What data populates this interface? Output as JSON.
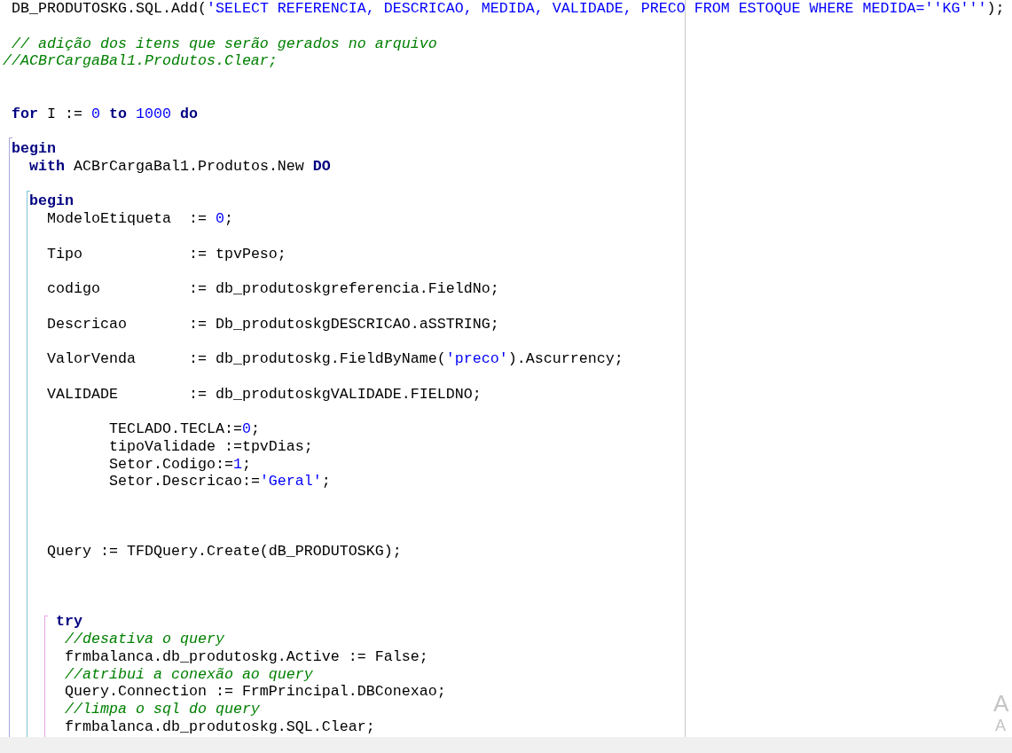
{
  "editor": {
    "lines": [
      {
        "kind": "code",
        "tokens": [
          {
            "kind": "plain",
            "text": " DB_PRODUTOSKG.SQL.Add("
          },
          {
            "kind": "string",
            "text": "'SELECT REFERENCIA, DESCRICAO, MEDIDA, VALIDADE, PRECO FROM ESTOQUE WHERE MEDIDA=''KG'''"
          },
          {
            "kind": "plain",
            "text": ");"
          }
        ]
      },
      {
        "kind": "blank"
      },
      {
        "kind": "code",
        "tokens": [
          {
            "kind": "comment",
            "text": " // adição dos itens que serão gerados no arquivo"
          }
        ]
      },
      {
        "kind": "code",
        "tokens": [
          {
            "kind": "comment",
            "text": "//ACBrCargaBal1.Produtos.Clear;"
          }
        ]
      },
      {
        "kind": "blank"
      },
      {
        "kind": "blank"
      },
      {
        "kind": "code",
        "tokens": [
          {
            "kind": "keyword",
            "text": " for"
          },
          {
            "kind": "plain",
            "text": " I := "
          },
          {
            "kind": "number",
            "text": "0"
          },
          {
            "kind": "keyword",
            "text": " to"
          },
          {
            "kind": "number",
            "text": " 1000"
          },
          {
            "kind": "keyword",
            "text": " do"
          }
        ]
      },
      {
        "kind": "blank"
      },
      {
        "kind": "code",
        "tokens": [
          {
            "kind": "keyword",
            "text": " begin"
          }
        ]
      },
      {
        "kind": "code",
        "tokens": [
          {
            "kind": "keyword",
            "text": "   with"
          },
          {
            "kind": "plain",
            "text": " ACBrCargaBal1.Produtos.New "
          },
          {
            "kind": "keyword",
            "text": "DO"
          }
        ]
      },
      {
        "kind": "blank"
      },
      {
        "kind": "code",
        "tokens": [
          {
            "kind": "keyword",
            "text": "   begin"
          }
        ]
      },
      {
        "kind": "code",
        "tokens": [
          {
            "kind": "plain",
            "text": "     ModeloEtiqueta  := "
          },
          {
            "kind": "number",
            "text": "0"
          },
          {
            "kind": "plain",
            "text": ";"
          }
        ]
      },
      {
        "kind": "blank"
      },
      {
        "kind": "code",
        "tokens": [
          {
            "kind": "plain",
            "text": "     Tipo            := tpvPeso;"
          }
        ]
      },
      {
        "kind": "blank"
      },
      {
        "kind": "code",
        "tokens": [
          {
            "kind": "plain",
            "text": "     codigo          := db_produtoskgreferencia.FieldNo;"
          }
        ]
      },
      {
        "kind": "blank"
      },
      {
        "kind": "code",
        "tokens": [
          {
            "kind": "plain",
            "text": "     Descricao       := Db_produtoskgDESCRICAO.aSSTRING;"
          }
        ]
      },
      {
        "kind": "blank"
      },
      {
        "kind": "code",
        "tokens": [
          {
            "kind": "plain",
            "text": "     ValorVenda      := db_produtoskg.FieldByName("
          },
          {
            "kind": "string",
            "text": "'preco'"
          },
          {
            "kind": "plain",
            "text": ").Ascurrency;"
          }
        ]
      },
      {
        "kind": "blank"
      },
      {
        "kind": "code",
        "tokens": [
          {
            "kind": "plain",
            "text": "     VALIDADE        := db_produtoskgVALIDADE.FIELDNO;"
          }
        ]
      },
      {
        "kind": "blank"
      },
      {
        "kind": "code",
        "tokens": [
          {
            "kind": "plain",
            "text": "            TECLADO.TECLA:="
          },
          {
            "kind": "number",
            "text": "0"
          },
          {
            "kind": "plain",
            "text": ";"
          }
        ]
      },
      {
        "kind": "code",
        "tokens": [
          {
            "kind": "plain",
            "text": "            tipoValidade :=tpvDias;"
          }
        ]
      },
      {
        "kind": "code",
        "tokens": [
          {
            "kind": "plain",
            "text": "            Setor.Codigo:="
          },
          {
            "kind": "number",
            "text": "1"
          },
          {
            "kind": "plain",
            "text": ";"
          }
        ]
      },
      {
        "kind": "code",
        "tokens": [
          {
            "kind": "plain",
            "text": "            Setor.Descricao:="
          },
          {
            "kind": "string",
            "text": "'Geral'"
          },
          {
            "kind": "plain",
            "text": ";"
          }
        ]
      },
      {
        "kind": "blank"
      },
      {
        "kind": "blank"
      },
      {
        "kind": "blank"
      },
      {
        "kind": "code",
        "tokens": [
          {
            "kind": "plain",
            "text": "     Query := TFDQuery.Create(dB_PRODUTOSKG);"
          }
        ]
      },
      {
        "kind": "blank"
      },
      {
        "kind": "blank"
      },
      {
        "kind": "blank"
      },
      {
        "kind": "code",
        "tokens": [
          {
            "kind": "keyword",
            "text": "      try"
          }
        ]
      },
      {
        "kind": "code",
        "tokens": [
          {
            "kind": "comment",
            "text": "       //desativa o query"
          }
        ]
      },
      {
        "kind": "code",
        "tokens": [
          {
            "kind": "plain",
            "text": "       frmbalanca.db_produtoskg.Active := False;"
          }
        ]
      },
      {
        "kind": "code",
        "tokens": [
          {
            "kind": "comment",
            "text": "       //atribui a conexão ao query"
          }
        ]
      },
      {
        "kind": "code",
        "tokens": [
          {
            "kind": "plain",
            "text": "       Query.Connection := FrmPrincipal.DBConexao;"
          }
        ]
      },
      {
        "kind": "code",
        "tokens": [
          {
            "kind": "comment",
            "text": "       //limpa o sql do query"
          }
        ]
      },
      {
        "kind": "code",
        "tokens": [
          {
            "kind": "plain",
            "text": "       frmbalanca.db_produtoskg.SQL.Clear;"
          }
        ]
      }
    ]
  },
  "os_notice": [
    "A",
    "A"
  ]
}
